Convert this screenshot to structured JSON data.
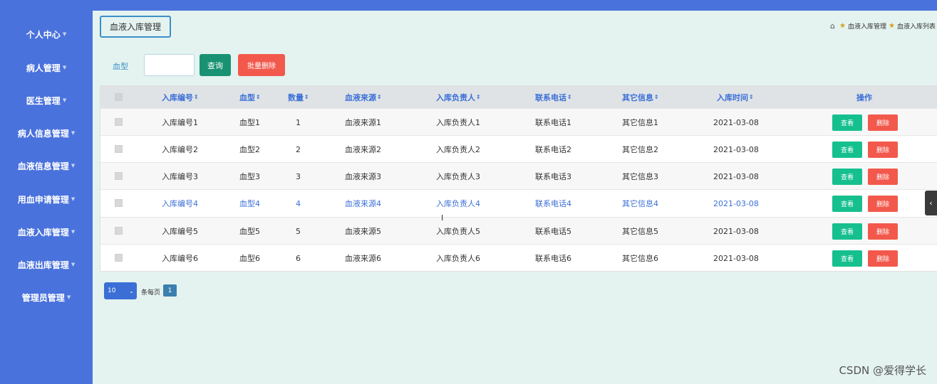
{
  "sidebar": {
    "items": [
      {
        "label": "个人中心"
      },
      {
        "label": "病人管理"
      },
      {
        "label": "医生管理"
      },
      {
        "label": "病人信息管理"
      },
      {
        "label": "血液信息管理"
      },
      {
        "label": "用血申请管理"
      },
      {
        "label": "血液入库管理"
      },
      {
        "label": "血液出库管理"
      },
      {
        "label": "管理员管理"
      }
    ]
  },
  "header": {
    "page_button": "血液入库管理",
    "breadcrumb": [
      "血液入库管理",
      "血液入库列表"
    ]
  },
  "search": {
    "label": "血型",
    "value": "",
    "query_button": "查询",
    "batch_delete_button": "批量删除"
  },
  "table": {
    "columns": [
      "入库编号",
      "血型",
      "数量",
      "血液来源",
      "入库负责人",
      "联系电话",
      "其它信息",
      "入库时间",
      "操作"
    ],
    "sort_icon": "⇕",
    "rows": [
      {
        "no": "入库编号1",
        "type": "血型1",
        "qty": "1",
        "source": "血液来源1",
        "person": "入库负责人1",
        "phone": "联系电话1",
        "info": "其它信息1",
        "time": "2021-03-08"
      },
      {
        "no": "入库编号2",
        "type": "血型2",
        "qty": "2",
        "source": "血液来源2",
        "person": "入库负责人2",
        "phone": "联系电话2",
        "info": "其它信息2",
        "time": "2021-03-08"
      },
      {
        "no": "入库编号3",
        "type": "血型3",
        "qty": "3",
        "source": "血液来源3",
        "person": "入库负责人3",
        "phone": "联系电话3",
        "info": "其它信息3",
        "time": "2021-03-08"
      },
      {
        "no": "入库编号4",
        "type": "血型4",
        "qty": "4",
        "source": "血液来源4",
        "person": "入库负责人4",
        "phone": "联系电话4",
        "info": "其它信息4",
        "time": "2021-03-08"
      },
      {
        "no": "入库编号5",
        "type": "血型5",
        "qty": "5",
        "source": "血液来源5",
        "person": "入库负责人5",
        "phone": "联系电话5",
        "info": "其它信息5",
        "time": "2021-03-08"
      },
      {
        "no": "入库编号6",
        "type": "血型6",
        "qty": "6",
        "source": "血液来源6",
        "person": "入库负责人6",
        "phone": "联系电话6",
        "info": "其它信息6",
        "time": "2021-03-08"
      }
    ],
    "view_label": "查看",
    "delete_label": "删除"
  },
  "pager": {
    "page_size": "10",
    "per_page_text": "条每页",
    "current_page": "1"
  },
  "watermark": "CSDN @爱得学长",
  "colors": {
    "sidebar": "#4a72dc",
    "main_bg": "#e4f3ef",
    "query": "#199273",
    "delete": "#f2594c",
    "view": "#16c08e",
    "header_link": "#3b6fd6"
  }
}
